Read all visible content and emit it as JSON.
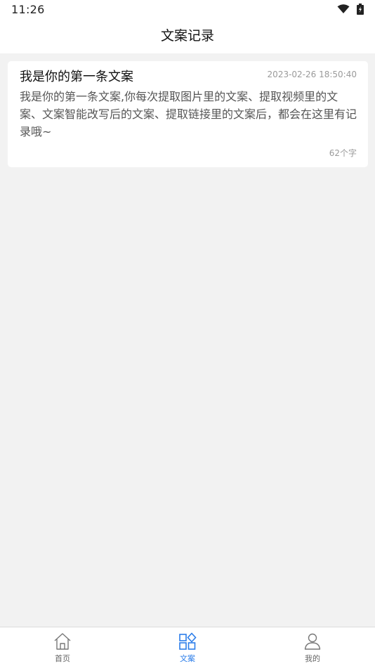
{
  "status_bar": {
    "time": "11:26",
    "icons": [
      "wifi-icon",
      "battery-charging-icon"
    ]
  },
  "header": {
    "title": "文案记录"
  },
  "records": [
    {
      "title": "我是你的第一条文案",
      "time": "2023-02-26 18:50:40",
      "content": "我是你的第一条文案,你每次提取图片里的文案、提取视频里的文案、文案智能改写后的文案、提取链接里的文案后，都会在这里有记录哦~",
      "count": "62个字"
    }
  ],
  "tabbar": {
    "items": [
      {
        "label": "首页",
        "icon": "home-icon",
        "active": false
      },
      {
        "label": "文案",
        "icon": "grid-diamond-icon",
        "active": true
      },
      {
        "label": "我的",
        "icon": "user-icon",
        "active": false
      }
    ]
  },
  "colors": {
    "accent": "#2b7de9",
    "background": "#f2f2f2",
    "card": "#ffffff",
    "muted_text": "#9a9a9a"
  }
}
